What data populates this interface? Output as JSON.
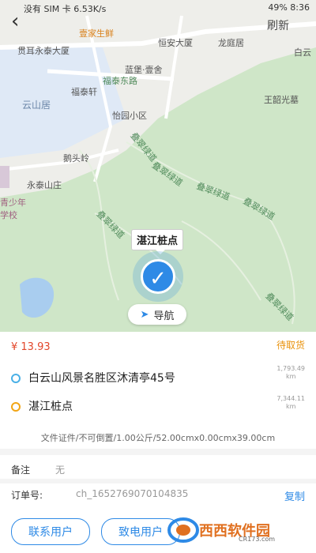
{
  "status_bar": {
    "left": "没有 SIM 卡  6.53K/s",
    "right": "49%  8:36"
  },
  "map": {
    "labels": [
      {
        "text": "壹家生鲜",
        "cls": ""
      },
      {
        "text": "恒安大厦",
        "cls": ""
      },
      {
        "text": "龙庭居",
        "cls": ""
      },
      {
        "text": "贯耳永泰大厦",
        "cls": ""
      },
      {
        "text": "蓝堡·壹舍",
        "cls": ""
      },
      {
        "text": "福泰东路",
        "cls": "road"
      },
      {
        "text": "福泰轩",
        "cls": ""
      },
      {
        "text": "云山居",
        "cls": "big"
      },
      {
        "text": "怡园小区",
        "cls": ""
      },
      {
        "text": "王韶光墓",
        "cls": ""
      },
      {
        "text": "鹅头岭",
        "cls": ""
      },
      {
        "text": "叠翠绿道",
        "cls": "road"
      },
      {
        "text": "叠翠绿道",
        "cls": "road"
      },
      {
        "text": "叠翠绿道",
        "cls": "road"
      },
      {
        "text": "叠翠绿道",
        "cls": "road"
      },
      {
        "text": "叠翠绿道",
        "cls": "road"
      },
      {
        "text": "永泰山庄",
        "cls": ""
      },
      {
        "text": "青少年学校",
        "cls": ""
      },
      {
        "text": "叠翠绿道",
        "cls": "road"
      },
      {
        "text": "白云",
        "cls": ""
      },
      {
        "text": "刷新",
        "cls": "big"
      }
    ],
    "callout": "湛江桩点",
    "nav_button": "导航"
  },
  "order": {
    "price": "¥ 13.93",
    "status": "待取货",
    "pickup_address": "白云山风景名胜区沐清亭45号",
    "pickup_distance_value": "1,793.49",
    "pickup_distance_unit": "km",
    "dropoff_address": "湛江桩点",
    "dropoff_distance_value": "7,344.11",
    "dropoff_distance_unit": "km",
    "spec": "文件证件/不可倒置/1.00公斤/52.00cmx0.00cmx39.00cm",
    "remark_label": "备注",
    "remark_value": "无",
    "order_no_label": "订单号:",
    "order_no_value": "ch_1652769070104835",
    "copy_label": "复制",
    "contact_user_button": "联系用户",
    "call_user_button": "致电用户"
  },
  "watermark": {
    "text": "西西软件园",
    "sub": "CR173.com"
  },
  "colors": {
    "accent": "#2e8ae6",
    "price": "#e2462a",
    "status": "#e9920c"
  }
}
